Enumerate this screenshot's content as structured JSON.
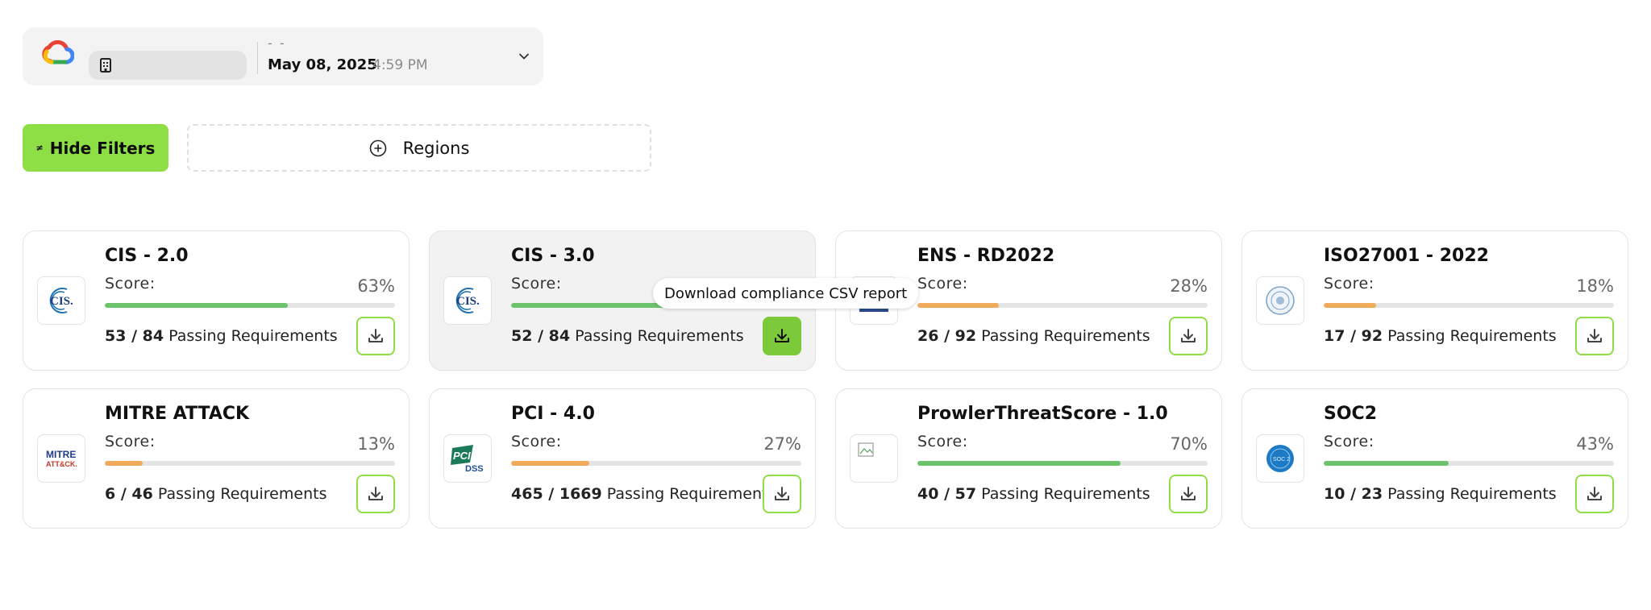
{
  "scan": {
    "name": "- -",
    "date": "May 08, 2025",
    "time": "4:59 PM"
  },
  "filters": {
    "hide_label": "Hide Filters",
    "regions_label": "Regions"
  },
  "tooltip": "Download compliance CSV report",
  "labels": {
    "score": "Score:",
    "passing": "Passing Requirements"
  },
  "colors": {
    "accent": "#8ede46",
    "bar_green": "#6cc36c",
    "bar_orange": "#f0ab5a"
  },
  "cards": [
    {
      "title": "CIS - 2.0",
      "score": "63%",
      "score_value": 63,
      "passed": "53",
      "total": "84",
      "logo": "cis-logo"
    },
    {
      "title": "CIS - 3.0",
      "score": "",
      "score_value": 63,
      "passed": "52",
      "total": "84",
      "logo": "cis-logo"
    },
    {
      "title": "ENS - RD2022",
      "score": "28%",
      "score_value": 28,
      "passed": "26",
      "total": "92",
      "logo": "ens-logo"
    },
    {
      "title": "ISO27001 - 2022",
      "score": "18%",
      "score_value": 18,
      "passed": "17",
      "total": "92",
      "logo": "iso-logo"
    },
    {
      "title": "MITRE ATTACK",
      "score": "13%",
      "score_value": 13,
      "passed": "6",
      "total": "46",
      "logo": "mitre-logo"
    },
    {
      "title": "PCI - 4.0",
      "score": "27%",
      "score_value": 27,
      "passed": "465",
      "total": "1669",
      "logo": "pci-logo"
    },
    {
      "title": "ProwlerThreatScore - 1.0",
      "score": "70%",
      "score_value": 70,
      "passed": "40",
      "total": "57",
      "logo": "broken-image-icon"
    },
    {
      "title": "SOC2",
      "score": "43%",
      "score_value": 43,
      "passed": "10",
      "total": "23",
      "logo": "soc2-logo"
    }
  ]
}
